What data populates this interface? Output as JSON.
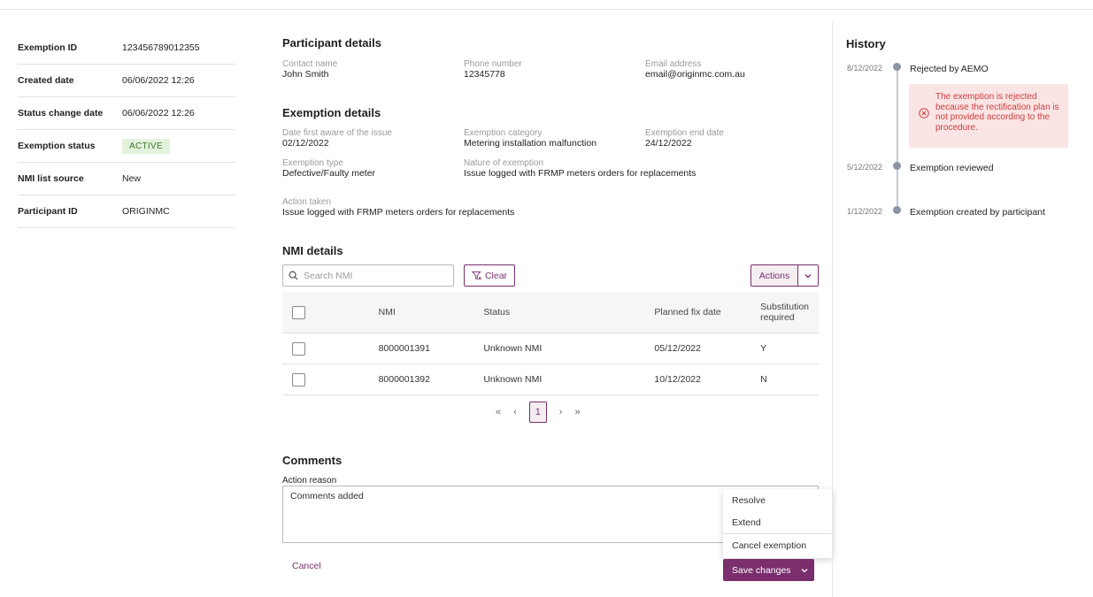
{
  "summary": {
    "rows": [
      {
        "label": "Exemption ID",
        "value": "123456789012355"
      },
      {
        "label": "Created date",
        "value": "06/06/2022 12:26"
      },
      {
        "label": "Status change date",
        "value": "06/06/2022 12:26"
      },
      {
        "label": "Exemption status",
        "value": "ACTIVE"
      },
      {
        "label": "NMI list source",
        "value": "New"
      },
      {
        "label": "Participant ID",
        "value": "ORIGINMC"
      }
    ]
  },
  "participant": {
    "title": "Participant details",
    "contact_name_label": "Contact name",
    "contact_name": "John Smith",
    "phone_label": "Phone number",
    "phone": "12345778",
    "email_label": "Email address",
    "email": "email@originmc.com.au"
  },
  "exemption": {
    "title": "Exemption details",
    "date_aware_label": "Date first aware of the issue",
    "date_aware": "02/12/2022",
    "category_label": "Exemption category",
    "category": "Metering installation malfunction",
    "end_date_label": "Exemption end date",
    "end_date": "24/12/2022",
    "type_label": "Exemption type",
    "type": "Defective/Faulty meter",
    "nature_label": "Nature of exemption",
    "nature": "Issue logged with FRMP meters orders for replacements",
    "action_label": "Action taken",
    "action": "Issue logged with FRMP meters orders for replacements"
  },
  "nmi": {
    "title": "NMI details",
    "search_placeholder": "Search NMI",
    "clear_label": "Clear",
    "actions_label": "Actions",
    "columns": [
      "NMI",
      "Status",
      "Planned fix date",
      "Substitution required"
    ],
    "rows": [
      {
        "nmi": "8000001391",
        "status": "Unknown NMI",
        "fix_date": "05/12/2022",
        "substitution": "Y"
      },
      {
        "nmi": "8000001392",
        "status": "Unknown NMI",
        "fix_date": "10/12/2022",
        "substitution": "N"
      }
    ],
    "pagination": {
      "first": "«",
      "prev": "‹",
      "current": "1",
      "next": "›",
      "last": "»"
    }
  },
  "comments": {
    "title": "Comments",
    "action_reason_label": "Action reason",
    "value": "Comments added",
    "cancel_label": "Cancel"
  },
  "save_menu": {
    "items": [
      "Resolve",
      "Extend",
      "Cancel exemption"
    ],
    "save_label": "Save changes"
  },
  "history": {
    "title": "History",
    "events": [
      {
        "date": "8/12/2022",
        "text": "Rejected by AEMO"
      },
      {
        "date": "5/12/2022",
        "text": "Exemption reviewed"
      },
      {
        "date": "1/12/2022",
        "text": "Exemption created by participant"
      }
    ],
    "alert_text": "The exemption is rejected because the rectification plan is not provided according to the procedure."
  },
  "colors": {
    "brand": "#7a2e6d",
    "active_badge_bg": "#e3f2dd",
    "alert_bg": "#fbe4e4",
    "alert_text": "#cc3d3d"
  }
}
